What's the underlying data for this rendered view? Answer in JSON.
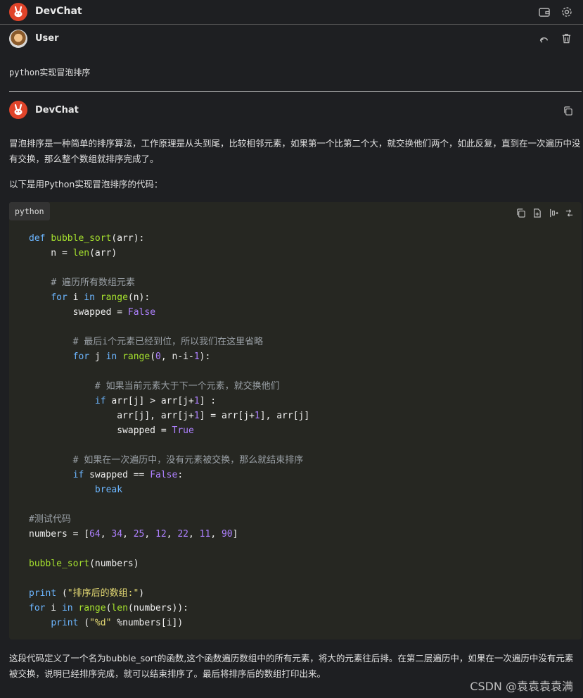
{
  "app": {
    "title": "DevChat"
  },
  "user": {
    "name": "User",
    "message": "python实现冒泡排序"
  },
  "bot": {
    "name": "DevChat"
  },
  "response": {
    "intro": "冒泡排序是一种简单的排序算法，工作原理是从头到尾，比较相邻元素，如果第一个比第二个大，就交换他们两个，如此反复，直到在一次遍历中没有交换，那么整个数组就排序完成了。",
    "lead": "以下是用Python实现冒泡排序的代码：",
    "code_lang": "python",
    "outro": "这段代码定义了一个名为bubble_sort的函数,这个函数遍历数组中的所有元素，将大的元素往后排。在第二层遍历中，如果在一次遍历中没有元素被交换，说明已经排序完成，就可以结束排序了。最后将排序后的数组打印出来。"
  },
  "code_lines": [
    "def bubble_sort(arr):",
    "    n = len(arr)",
    "",
    "    # 遍历所有数组元素",
    "    for i in range(n):",
    "        swapped = False",
    "",
    "        # 最后i个元素已经到位，所以我们在这里省略",
    "        for j in range(0, n-i-1):",
    "",
    "            # 如果当前元素大于下一个元素，就交换他们",
    "            if arr[j] > arr[j+1] :",
    "                arr[j], arr[j+1] = arr[j+1], arr[j]",
    "                swapped = True",
    "",
    "        # 如果在一次遍历中，没有元素被交换，那么就结束排序",
    "        if swapped == False:",
    "            break",
    "",
    "#测试代码",
    "numbers = [64, 34, 25, 12, 22, 11, 90]",
    "",
    "bubble_sort(numbers)",
    "",
    "print (\"排序后的数组:\")",
    "for i in range(len(numbers)):",
    "    print (\"%d\" %numbers[i])"
  ],
  "watermark": "CSDN @袁袁袁袁满",
  "icons": {
    "logo": "rabbit-logo-icon",
    "wallet": "wallet-icon",
    "settings": "gear-icon",
    "undo": "undo-icon",
    "delete": "trash-icon",
    "copy": "copy-icon",
    "new_file": "new-file-icon",
    "insert": "insert-code-icon",
    "diff": "diff-icon"
  },
  "colors": {
    "accent": "#e0442a",
    "background": "#1e1f22",
    "code_bg": "#262722"
  }
}
